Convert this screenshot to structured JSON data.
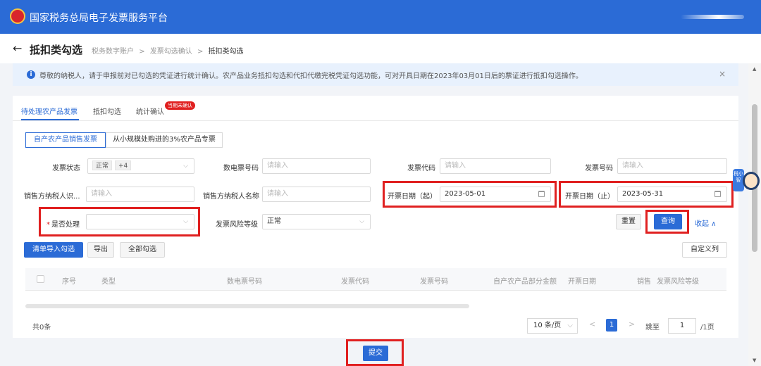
{
  "app": {
    "title": "国家税务总局电子发票服务平台"
  },
  "header": {
    "back_icon": "←",
    "page_title": "抵扣类勾选",
    "breadcrumbs": [
      "税务数字账户",
      "发票勾选确认",
      "抵扣类勾选"
    ],
    "separator": ">"
  },
  "notice": {
    "icon": "i",
    "text": "尊敬的纳税人，请于申报前对已勾选的凭证进行统计确认。农产品业务抵扣勾选和代扣代缴完税凭证勾选功能，可对开具日期在2023年03月01日后的票证进行抵扣勾选操作。",
    "close": "×"
  },
  "tabs": [
    {
      "label": "待处理农产品发票",
      "active": true
    },
    {
      "label": "抵扣勾选",
      "active": false
    },
    {
      "label": "统计确认",
      "active": false
    }
  ],
  "tab_badge": "当期未确认",
  "segments": [
    {
      "label": "自产农产品销售发票",
      "active": true
    },
    {
      "label": "从小规模处购进的3%农产品专票",
      "active": false
    }
  ],
  "filters": {
    "status": {
      "label": "发票状态",
      "tag": "正常",
      "more": "+4",
      "chevron": "⌵"
    },
    "digital_no": {
      "label": "数电票号码",
      "placeholder": "请输入"
    },
    "invoice_code": {
      "label": "发票代码",
      "placeholder": "请输入"
    },
    "invoice_no": {
      "label": "发票号码",
      "placeholder": "请输入"
    },
    "seller_tax_id": {
      "label": "销售方纳税人识...",
      "placeholder": "请输入"
    },
    "seller_name": {
      "label": "销售方纳税人名称",
      "placeholder": "请输入"
    },
    "date_start": {
      "label": "开票日期（起）",
      "value": "2023-05-01"
    },
    "date_end": {
      "label": "开票日期（止）",
      "value": "2023-05-31"
    },
    "processed": {
      "label": "是否处理",
      "required_mark": "*",
      "chevron": "⌵"
    },
    "risk": {
      "label": "发票风险等级",
      "value": "正常",
      "chevron": "⌵"
    }
  },
  "buttons": {
    "reset": "重置",
    "query": "查询",
    "collapse": "收起 ∧",
    "import": "清单导入勾选",
    "export": "导出",
    "select_all": "全部勾选",
    "custom_columns": "自定义列",
    "submit": "提交"
  },
  "table": {
    "columns": [
      "序号",
      "类型",
      "数电票号码",
      "发票代码",
      "发票号码",
      "自产农产品部分金额",
      "开票日期",
      "销售",
      "发票风险等级"
    ]
  },
  "pagination": {
    "total": "共0条",
    "page_size": "10 条/页",
    "prev": "<",
    "current_page": "1",
    "next": ">",
    "jump_label": "跳至",
    "jump_value": "1",
    "total_pages": "/1页"
  },
  "scrollbar": {
    "up": "▲",
    "down": "▼"
  },
  "assistant": {
    "label": "税小智"
  },
  "colors": {
    "primary": "#2b6bd6",
    "highlight": "#e02020",
    "notice_bg": "#e8f1fd"
  }
}
